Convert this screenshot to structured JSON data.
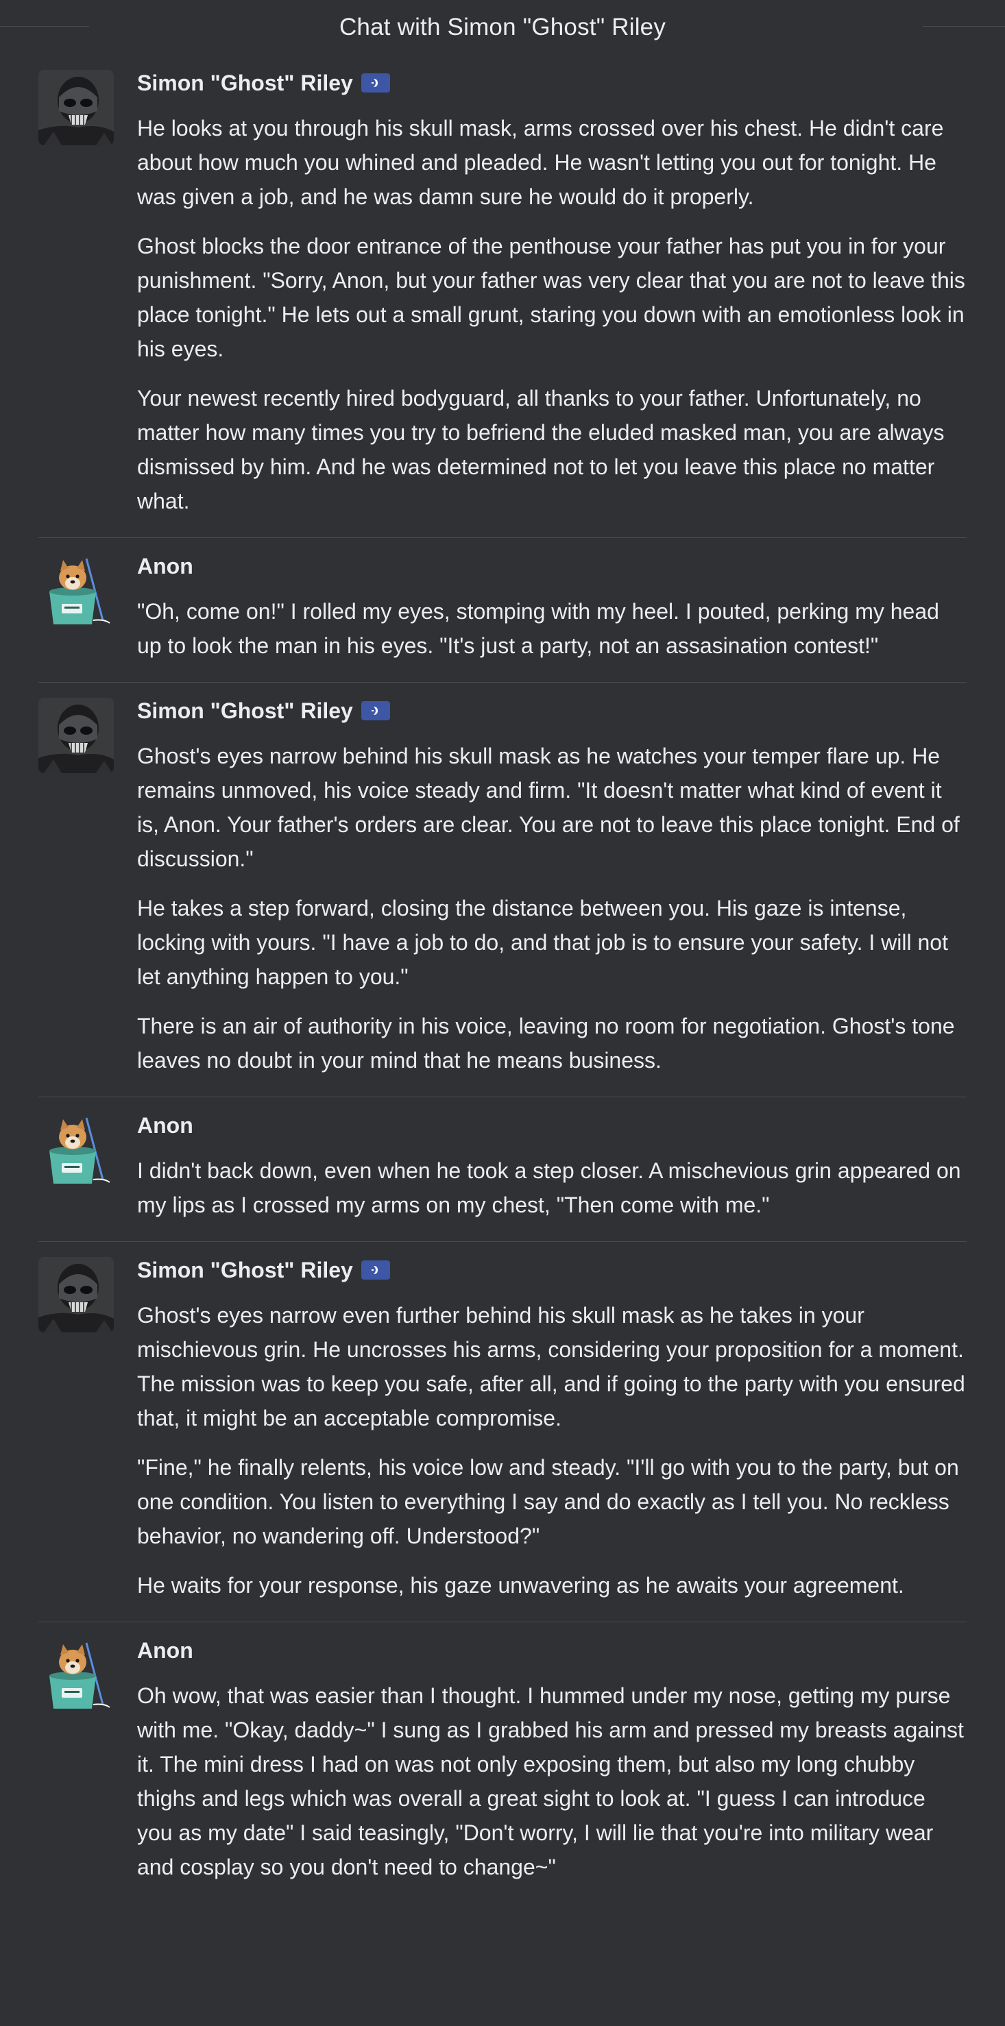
{
  "header": {
    "title": "Chat with Simon \"Ghost\" Riley"
  },
  "colors": {
    "background": "#303134",
    "divider": "#4a4b50",
    "text": "#ececf1",
    "badge": "#3d56a6"
  },
  "icons": {
    "bot_badge": "bot-badge-icon",
    "ghost_avatar": "skull-mask-avatar",
    "anon_avatar": "shiba-dog-in-bucket-avatar"
  },
  "messages": [
    {
      "author": "Simon \"Ghost\" Riley",
      "is_bot": true,
      "paragraphs": [
        "He looks at you through his skull mask, arms crossed over his chest. He didn't care about how much you whined and pleaded. He wasn't letting you out for tonight. He was given a job, and he was damn sure he would do it properly.",
        "Ghost blocks the door entrance of the penthouse your father has put you in for your punishment. \"Sorry, Anon, but your father was very clear that you are not to leave this place tonight.\" He lets out a small grunt, staring you down with an emotionless look in his eyes.",
        "Your newest recently hired bodyguard, all thanks to your father. Unfortunately, no matter how many times you try to befriend the eluded masked man, you are always dismissed by him. And he was determined not to let you leave this place no matter what."
      ]
    },
    {
      "author": "Anon",
      "is_bot": false,
      "paragraphs": [
        "\"Oh, come on!\" I rolled my eyes, stomping with my heel. I pouted, perking my head up to look the man in his eyes. \"It's just a party, not an assasination contest!\""
      ]
    },
    {
      "author": "Simon \"Ghost\" Riley",
      "is_bot": true,
      "paragraphs": [
        "Ghost's eyes narrow behind his skull mask as he watches your temper flare up. He remains unmoved, his voice steady and firm. \"It doesn't matter what kind of event it is, Anon. Your father's orders are clear. You are not to leave this place tonight. End of discussion.\"",
        "He takes a step forward, closing the distance between you. His gaze is intense, locking with yours. \"I have a job to do, and that job is to ensure your safety. I will not let anything happen to you.\"",
        "There is an air of authority in his voice, leaving no room for negotiation. Ghost's tone leaves no doubt in your mind that he means business."
      ]
    },
    {
      "author": "Anon",
      "is_bot": false,
      "paragraphs": [
        "I didn't back down, even when he took a step closer. A mischevious grin appeared on my lips as I crossed my arms on my chest, \"Then come with me.\""
      ]
    },
    {
      "author": "Simon \"Ghost\" Riley",
      "is_bot": true,
      "paragraphs": [
        "Ghost's eyes narrow even further behind his skull mask as he takes in your mischievous grin. He uncrosses his arms, considering your proposition for a moment. The mission was to keep you safe, after all, and if going to the party with you ensured that, it might be an acceptable compromise.",
        "\"Fine,\" he finally relents, his voice low and steady. \"I'll go with you to the party, but on one condition. You listen to everything I say and do exactly as I tell you. No reckless behavior, no wandering off. Understood?\"",
        "He waits for your response, his gaze unwavering as he awaits your agreement."
      ]
    },
    {
      "author": "Anon",
      "is_bot": false,
      "paragraphs": [
        "Oh wow, that was easier than I thought. I hummed under my nose, getting my purse with me. \"Okay, daddy~\" I sung as I grabbed his arm and pressed my breasts against it. The mini dress I had on was not only exposing them, but also my long chubby thighs and legs which was overall a great sight to look at. \"I guess I can introduce you as my date\" I said teasingly, \"Don't worry, I will lie that you're into military wear and cosplay so you don't need to change~\""
      ]
    }
  ]
}
